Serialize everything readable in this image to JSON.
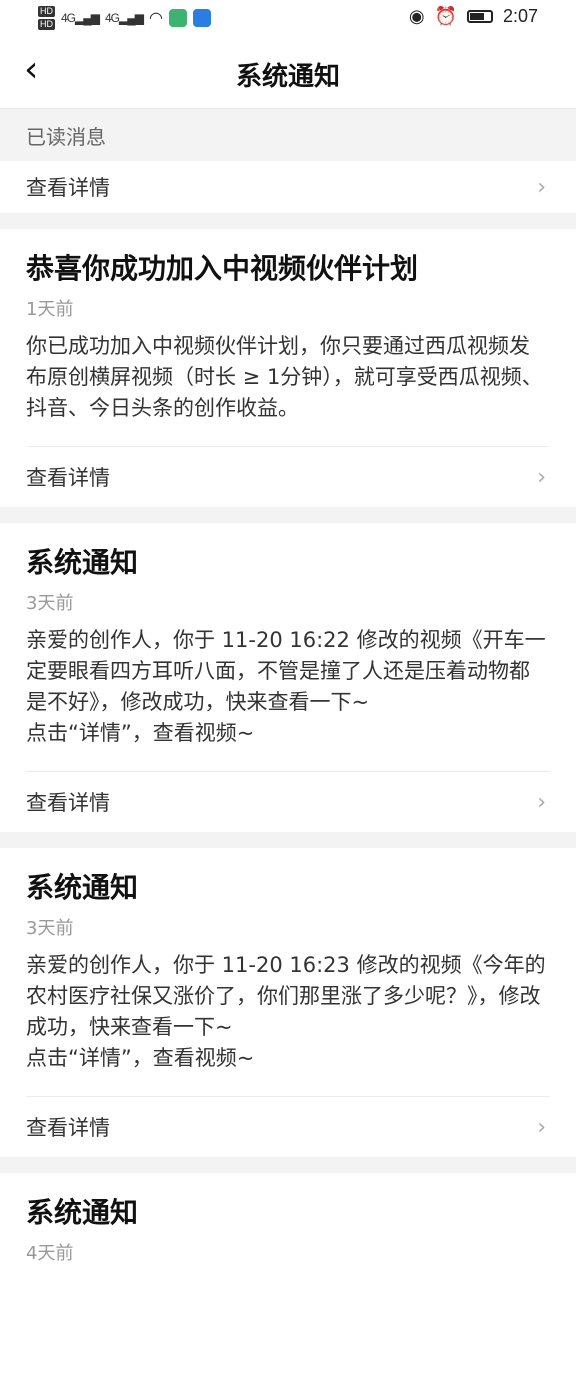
{
  "status_bar": {
    "hd1": "HD",
    "hd2": "HD",
    "signal1": "4G",
    "signal2": "4G",
    "time": "2:07",
    "icons": [
      "eye-icon",
      "alarm-icon",
      "battery-icon",
      "wifi-icon"
    ]
  },
  "nav": {
    "back_icon": "‹",
    "title": "系统通知"
  },
  "read_section": {
    "header": "已读消息",
    "detail_label": "查看详情"
  },
  "notices": [
    {
      "title": "恭喜你成功加入中视频伙伴计划",
      "time": "1天前",
      "body": "你已成功加入中视频伙伴计划，你只要通过西瓜视频发布原创横屏视频（时长 ≥ 1分钟），就可享受西瓜视频、抖音、今日头条的创作收益。",
      "detail_label": "查看详情"
    },
    {
      "title": "系统通知",
      "time": "3天前",
      "body": "亲爱的创作人，你于 11-20 16:22 修改的视频《开车一定要眼看四方耳听八面，不管是撞了人还是压着动物都是不好》，修改成功，快来查看一下~\n点击“详情”，查看视频~",
      "detail_label": "查看详情"
    },
    {
      "title": "系统通知",
      "time": "3天前",
      "body": "亲爱的创作人，你于 11-20 16:23 修改的视频《今年的农村医疗社保又涨价了，你们那里涨了多少呢？》，修改成功，快来查看一下~\n点击“详情”，查看视频~",
      "detail_label": "查看详情"
    },
    {
      "title": "系统通知",
      "time": "4天前"
    }
  ],
  "chevron": "›"
}
